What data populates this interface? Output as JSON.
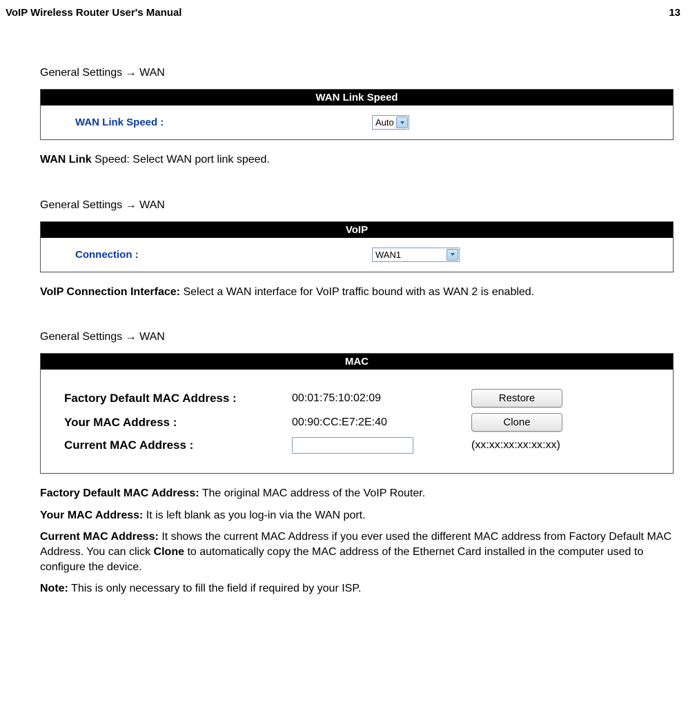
{
  "header": {
    "title": "VoIP Wireless Router User's Manual",
    "page_number": "13"
  },
  "breadcrumbs": {
    "wan_link": "General Settings  →  WAN",
    "voip": "General Settings  →  WAN",
    "mac": "General Settings  →  WAN"
  },
  "panels": {
    "wan_link": {
      "title": "WAN Link Speed",
      "field_label": "WAN Link Speed :",
      "select_value": "Auto"
    },
    "voip": {
      "title": "VoIP",
      "field_label": "Connection :",
      "select_value": "WAN1"
    },
    "mac": {
      "title": "MAC",
      "rows": {
        "factory": {
          "label": "Factory Default MAC Address :",
          "value": "00:01:75:10:02:09",
          "button": "Restore"
        },
        "your": {
          "label": "Your MAC Address :",
          "value": "00:90:CC:E7:2E:40",
          "button": "Clone"
        },
        "current": {
          "label": "Current MAC Address :",
          "input_value": "",
          "hint": "(xx:xx:xx:xx:xx:xx)"
        }
      }
    }
  },
  "descriptions": {
    "wan_link_bold": "WAN Link",
    "wan_link_rest": " Speed: Select WAN port link speed.",
    "voip_bold": "VoIP Connection Interface:",
    "voip_rest": " Select a WAN interface for VoIP traffic bound with as WAN 2 is enabled.",
    "factory_bold": "Factory Default MAC Address:",
    "factory_rest": " The original MAC address of the VoIP Router.",
    "your_bold": "Your MAC Address:",
    "your_rest": " It is left blank as you log-in via the WAN port.",
    "current_bold": "Current MAC Address:",
    "current_rest_a": " It shows the current MAC Address if you ever used the different MAC address from Factory Default MAC Address. You can click ",
    "current_clone": "Clone",
    "current_rest_b": " to automatically copy the MAC address of the Ethernet Card installed in the computer used to configure the device.",
    "note_bold": "Note:",
    "note_rest": " This is only necessary to fill the field if required by your ISP."
  }
}
